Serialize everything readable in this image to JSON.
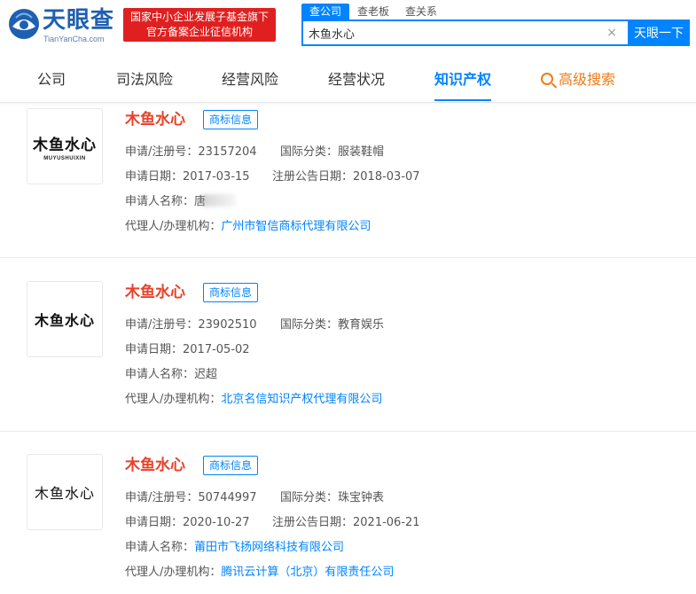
{
  "brand": {
    "title": "天眼查",
    "subtitle": "TianYanCha.com",
    "banner_line1": "国家中小企业发展子基金旗下",
    "banner_line2": "官方备案企业征信机构",
    "color": "#1f5fb0"
  },
  "search": {
    "tabs": [
      {
        "label": "查公司",
        "active": true
      },
      {
        "label": "查老板",
        "active": false
      },
      {
        "label": "查关系",
        "active": false
      }
    ],
    "value": "木鱼水心",
    "clear_glyph": "×",
    "button_label": "天眼一下",
    "accent": "#0084ff"
  },
  "nav": {
    "items": [
      {
        "label": "公司",
        "active": false
      },
      {
        "label": "司法风险",
        "active": false
      },
      {
        "label": "经营风险",
        "active": false
      },
      {
        "label": "经营状况",
        "active": false
      },
      {
        "label": "知识产权",
        "active": true
      }
    ],
    "advanced_label": "高级搜索"
  },
  "labels": {
    "reg_no": "申请/注册号：",
    "intl_class": "国际分类：",
    "apply_date": "申请日期：",
    "announce_date": "注册公告日期：",
    "applicant": "申请人名称：",
    "agent": "代理人/办理机构："
  },
  "trademarks": [
    {
      "name": "木鱼水心",
      "tag": "商标信息",
      "logo_text": "木鱼水心",
      "logo_sub": "MUYUSHUIXIN",
      "reg_no": "23157204",
      "intl_class": "服装鞋帽",
      "apply_date": "2017-03-15",
      "announce_date": "2018-03-07",
      "applicant": "唐",
      "agent": "广州市智信商标代理有限公司"
    },
    {
      "name": "木鱼水心",
      "tag": "商标信息",
      "logo_text": "木鱼水心",
      "reg_no": "23902510",
      "intl_class": "教育娱乐",
      "apply_date": "2017-05-02",
      "applicant": "迟超",
      "agent": "北京名信知识产权代理有限公司"
    },
    {
      "name": "木鱼水心",
      "tag": "商标信息",
      "logo_text": "木鱼水心",
      "reg_no": "50744997",
      "intl_class": "珠宝钟表",
      "apply_date": "2020-10-27",
      "announce_date": "2021-06-21",
      "applicant": "莆田市飞扬网络科技有限公司",
      "agent": "腾讯云计算（北京）有限责任公司"
    }
  ]
}
